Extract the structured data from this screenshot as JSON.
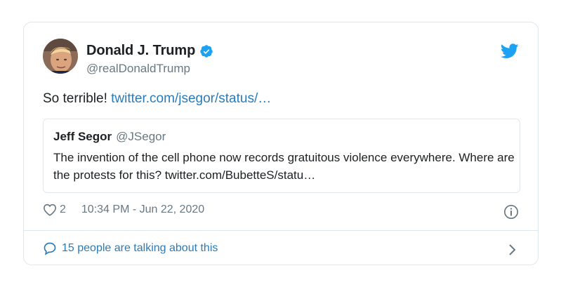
{
  "author": {
    "display_name": "Donald J. Trump",
    "handle": "@realDonaldTrump",
    "verified": true
  },
  "tweet": {
    "text": "So terrible!",
    "link": "twitter.com/jsegor/status/…"
  },
  "quoted_tweet": {
    "author_name": "Jeff Segor",
    "author_handle": "@JSegor",
    "text": "The invention of the cell phone now records gratuitous violence everywhere. Where are the protests for this? twitter.com/BubetteS/statu…"
  },
  "meta": {
    "like_count": "2",
    "timestamp": "10:34 PM - Jun 22, 2020"
  },
  "footer": {
    "conversation_text": "15 people are talking about this"
  },
  "colors": {
    "accent": "#1da1f2",
    "link": "#2b7bb9",
    "muted": "#697882",
    "border": "#e1e8ed"
  },
  "icons": [
    "avatar",
    "verified-badge-icon",
    "twitter-bird-icon",
    "heart-icon",
    "info-icon",
    "speech-bubble-icon",
    "chevron-right-icon"
  ]
}
